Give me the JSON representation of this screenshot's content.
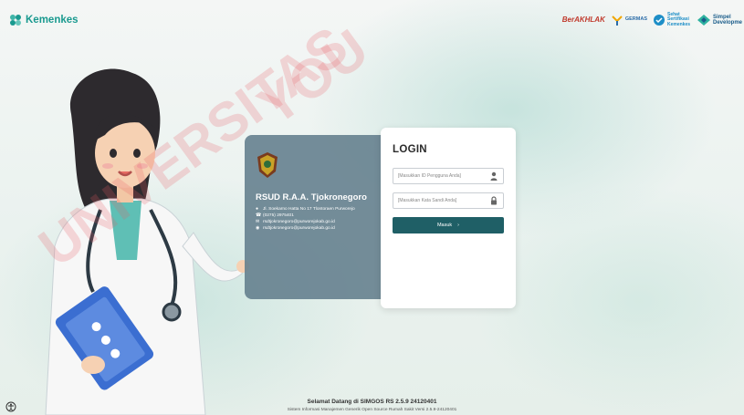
{
  "header": {
    "brand_label": "Kemenkes",
    "logos": [
      "BerAKHLAK",
      "GERMAS",
      "Sehat Sertifikasi Kemenkes",
      "Simpel Developme"
    ]
  },
  "info_panel": {
    "hospital_name": "RSUD R.A.A. Tjokronegoro",
    "address": "Jl. Soekarno Hatta No 17 Tlontoraen Purworejo",
    "phone": "(0275) 2975401",
    "email": "rsdtjokronegoro@purworejokab.go.id",
    "email2": "rsdtjokronegoro@purworejokab.go.id"
  },
  "login": {
    "title": "LOGIN",
    "username_placeholder": "[Masukkan ID Pengguna Anda]",
    "password_placeholder": "[Masukkan Kata Sandi Anda]",
    "submit_label": "Masuk"
  },
  "footer": {
    "welcome": "Selamat Datang di SIMGOS RS 2.5.9 24120401",
    "subtitle": "Sistem Informasi Manajemen Generik Open Source Rumah Sakit Versi 2.5.9-24120401"
  },
  "watermark": {
    "text1": "UNIVERSITAS",
    "text2": "YOU"
  },
  "colors": {
    "brand": "#1a9a8f",
    "panel": "#627d8c",
    "button": "#1f5f66",
    "watermark": "#e85a66"
  },
  "icons": {
    "brand": "kemenkes-logo-icon",
    "user": "user-icon",
    "lock": "lock-icon",
    "chevron": "chevron-right-icon",
    "crest": "hospital-crest-icon"
  }
}
